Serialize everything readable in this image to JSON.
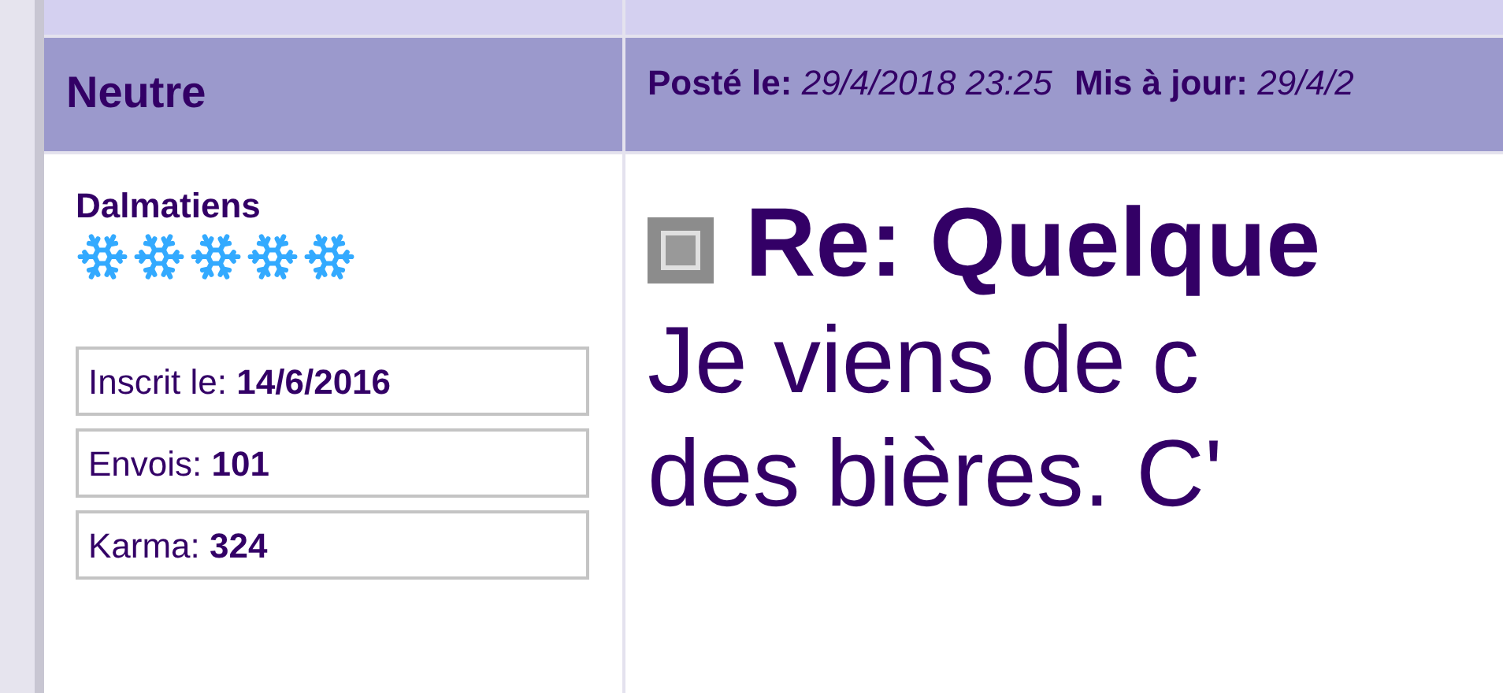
{
  "header": {
    "rank": "Neutre",
    "posted_label": "Posté le:",
    "posted_value": "29/4/2018 23:25",
    "updated_label": "Mis à jour:",
    "updated_value": "29/4/2"
  },
  "author": {
    "name": "Dalmatiens",
    "stars": 5,
    "stats": [
      {
        "label": "Inscrit le:",
        "value": "14/6/2016"
      },
      {
        "label": "Envois:",
        "value": "101"
      },
      {
        "label": "Karma:",
        "value": "324"
      }
    ]
  },
  "post": {
    "title": "Re: Quelque",
    "lines": [
      "Je viens de c",
      "des bières. C'"
    ]
  }
}
